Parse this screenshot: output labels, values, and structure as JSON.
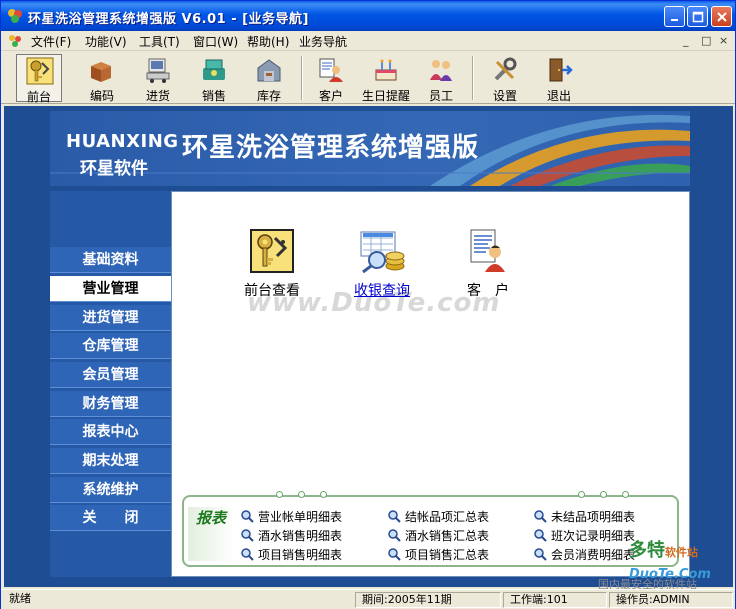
{
  "window": {
    "title": "环星洗浴管理系统增强版  V6.01 - [业务导航]"
  },
  "menu": {
    "items": [
      "文件(F)",
      "功能(V)",
      "工具(T)",
      "窗口(W)",
      "帮助(H)",
      "业务导航"
    ],
    "mdi_controls": [
      "_",
      "□",
      "×"
    ]
  },
  "toolbar": {
    "items": [
      {
        "label": "前台",
        "icon": "keys-icon",
        "active": true
      },
      {
        "label": "编码",
        "icon": "boxes-icon"
      },
      {
        "label": "进货",
        "icon": "computer-cart-icon"
      },
      {
        "label": "销售",
        "icon": "cash-register-icon"
      },
      {
        "label": "库存",
        "icon": "warehouse-icon"
      },
      {
        "label": "客户",
        "icon": "customer-icon"
      },
      {
        "label": "生日提醒",
        "icon": "birthday-cake-icon"
      },
      {
        "label": "员工",
        "icon": "staff-icon"
      },
      {
        "label": "设置",
        "icon": "tools-icon"
      },
      {
        "label": "退出",
        "icon": "exit-door-icon"
      }
    ]
  },
  "banner": {
    "english_name": "HUANXING",
    "company": "环星软件",
    "product_title": "环星洗浴管理系统增强版"
  },
  "nav": {
    "items": [
      "基础资料",
      "营业管理",
      "进货管理",
      "仓库管理",
      "会员管理",
      "财务管理",
      "报表中心",
      "期末处理",
      "系统维护",
      "关　　闭"
    ],
    "active_index": 1
  },
  "panel": {
    "icons": [
      {
        "label": "前台查看",
        "icon": "front-desk-keys-icon"
      },
      {
        "label": "收银查询",
        "icon": "cashier-query-icon",
        "link": true
      },
      {
        "label": "客　户",
        "icon": "customer-icon"
      }
    ],
    "watermark": "www.DuoTe.com"
  },
  "reports": {
    "title": "报表",
    "items": [
      "营业帐单明细表",
      "结帐品项汇总表",
      "未结品项明细表",
      "酒水销售明细表",
      "酒水销售汇总表",
      "班次记录明细表",
      "项目销售明细表",
      "项目销售汇总表",
      "会员消费明细表"
    ]
  },
  "overlay": {
    "brand": "多特",
    "brand_sub": "软件站",
    "domain": "DuoTe.Com",
    "slogan": "国内最安全的软件站"
  },
  "status": {
    "ready": "就绪",
    "period": "期间:2005年11期",
    "terminal": "工作端:101",
    "operator": "操作员:ADMIN"
  },
  "colors": {
    "title_bar": "#0055E5",
    "client_bg": "#1F4D94",
    "nav_bg": "#2F65B7",
    "reports_border": "#8DB58A"
  }
}
